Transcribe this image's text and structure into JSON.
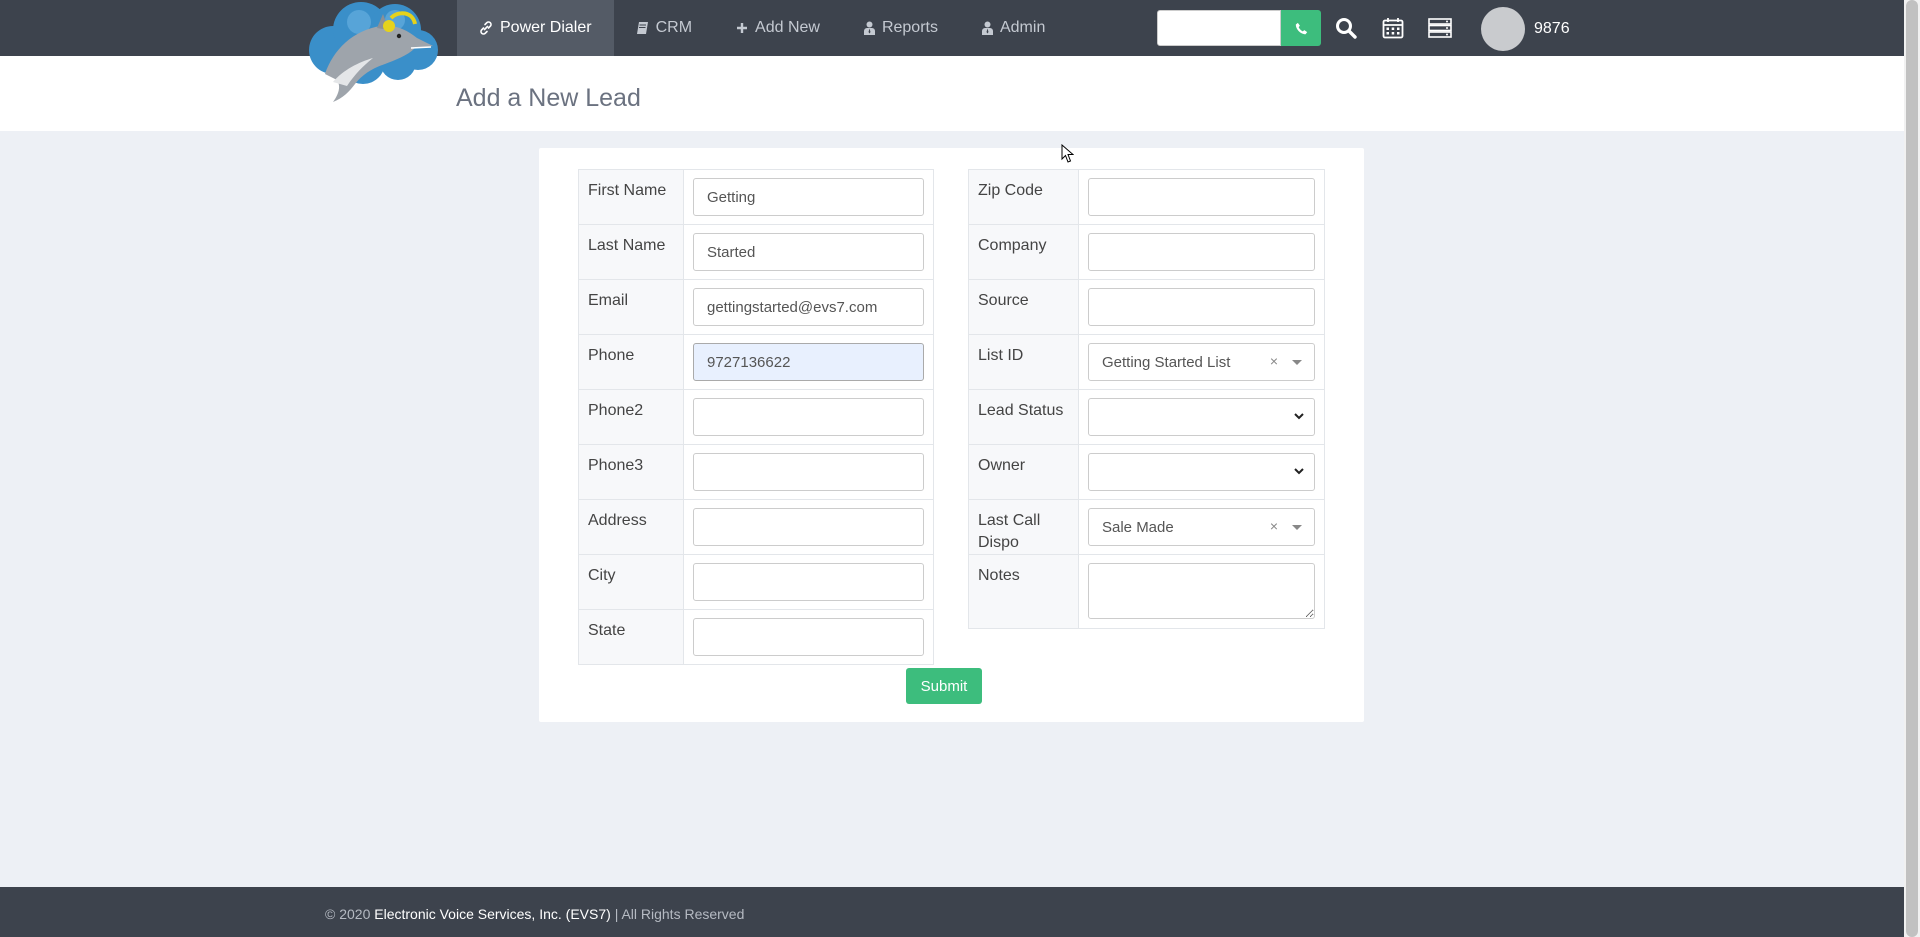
{
  "nav": {
    "items": [
      {
        "label": "Power Dialer",
        "icon": "link-icon",
        "active": true
      },
      {
        "label": "CRM",
        "icon": "book-icon"
      },
      {
        "label": "Add New",
        "icon": "plus-icon"
      },
      {
        "label": "Reports",
        "icon": "user-tie-icon"
      },
      {
        "label": "Admin",
        "icon": "user-tie-icon"
      }
    ],
    "search_value": "",
    "user_ext": "9876"
  },
  "page": {
    "title": "Add a New Lead"
  },
  "form": {
    "left": {
      "first_name": {
        "label": "First Name",
        "value": "Getting"
      },
      "last_name": {
        "label": "Last Name",
        "value": "Started"
      },
      "email": {
        "label": "Email",
        "value": "gettingstarted@evs7.com"
      },
      "phone": {
        "label": "Phone",
        "value": "9727136622"
      },
      "phone2": {
        "label": "Phone2",
        "value": ""
      },
      "phone3": {
        "label": "Phone3",
        "value": ""
      },
      "address": {
        "label": "Address",
        "value": ""
      },
      "city": {
        "label": "City",
        "value": ""
      },
      "state": {
        "label": "State",
        "value": ""
      }
    },
    "right": {
      "zip": {
        "label": "Zip Code",
        "value": ""
      },
      "company": {
        "label": "Company",
        "value": ""
      },
      "source": {
        "label": "Source",
        "value": ""
      },
      "list_id": {
        "label": "List ID",
        "value": "Getting Started List",
        "clear": "×"
      },
      "lead_status": {
        "label": "Lead Status",
        "value": ""
      },
      "owner": {
        "label": "Owner",
        "value": ""
      },
      "last_call_dispo": {
        "label": "Last Call Dispo",
        "value": "Sale Made",
        "clear": "×"
      },
      "notes": {
        "label": "Notes",
        "value": ""
      }
    },
    "submit_label": "Submit"
  },
  "footer": {
    "prefix": "© 2020",
    "company": "Electronic Voice Services, Inc. (EVS7)",
    "suffix": "| All Rights Reserved"
  },
  "colors": {
    "navbar": "#3d434d",
    "accent_green": "#3dbd7d",
    "background": "#edf0f5"
  }
}
